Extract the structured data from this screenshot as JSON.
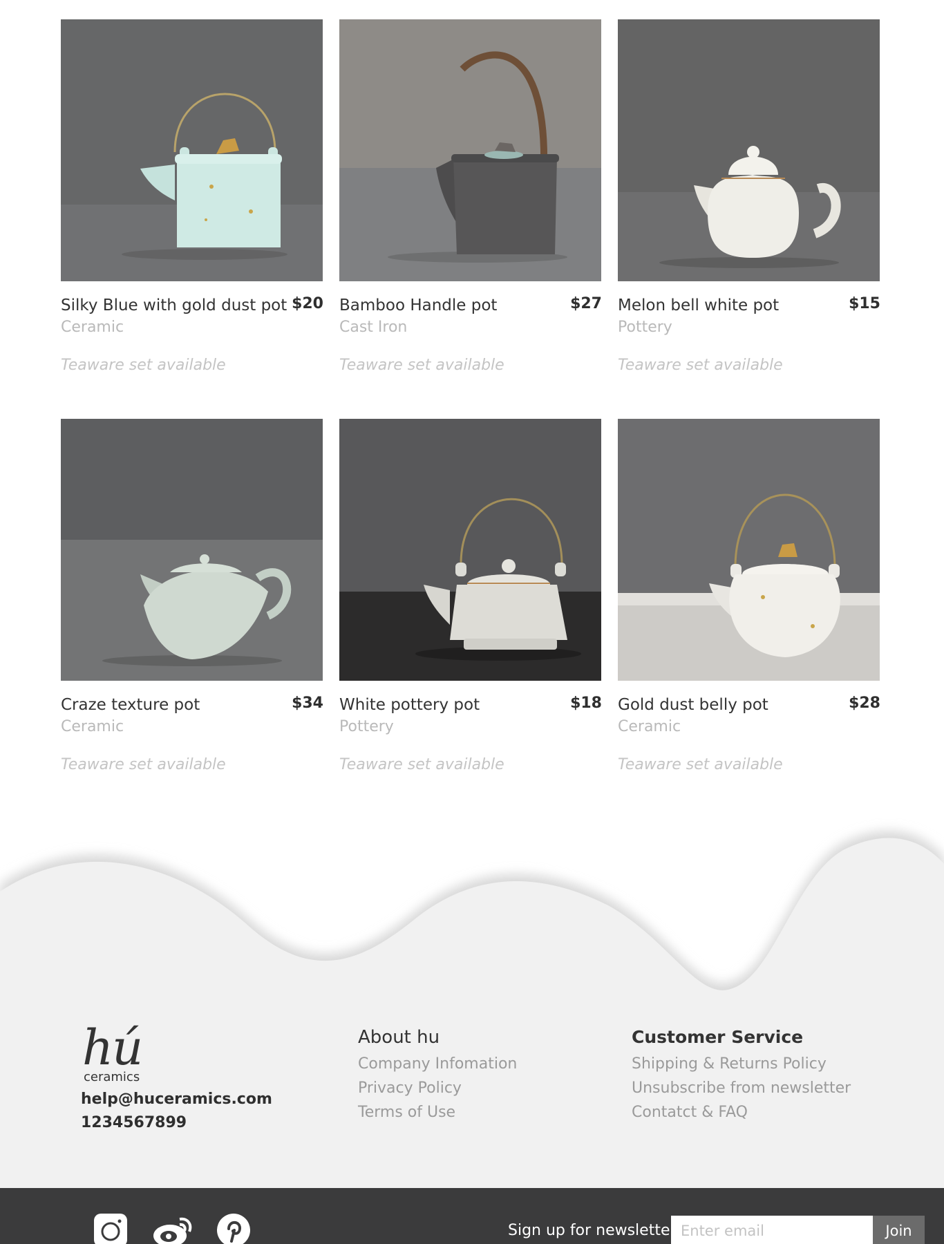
{
  "products": [
    {
      "name": "Silky Blue with gold dust pot",
      "price": "$20",
      "material": "Ceramic",
      "note": "Teaware set available",
      "icon": "teapot-handle-blue-image"
    },
    {
      "name": "Bamboo Handle pot",
      "price": "$27",
      "material": "Cast Iron",
      "note": "Teaware set available",
      "icon": "teapot-bamboo-image"
    },
    {
      "name": "Melon bell white pot",
      "price": "$15",
      "material": "Pottery",
      "note": "Teaware set available",
      "icon": "teapot-white-image"
    },
    {
      "name": "Craze texture pot",
      "price": "$34",
      "material": "Ceramic",
      "note": "Teaware set available",
      "icon": "teapot-craze-image"
    },
    {
      "name": "White pottery pot",
      "price": "$18",
      "material": "Pottery",
      "note": "Teaware set available",
      "icon": "teapot-pottery-image"
    },
    {
      "name": "Gold dust belly pot",
      "price": "$28",
      "material": "Ceramic",
      "note": "Teaware set available",
      "icon": "teapot-gold-belly-image"
    }
  ],
  "footer": {
    "brand": {
      "logo": "hú",
      "sub": "ceramics",
      "email": "help@huceramics.com",
      "phone": "1234567899"
    },
    "about": {
      "title": "About hu",
      "links": [
        "Company Infomation",
        "Privacy Policy",
        "Terms of Use"
      ]
    },
    "service": {
      "title": "Customer Service",
      "links": [
        "Shipping & Returns Policy",
        "Unsubscribe from newsletter",
        "Contatct & FAQ"
      ]
    }
  },
  "bottom_bar": {
    "social_icons": [
      "instagram-icon",
      "weibo-icon",
      "pinterest-icon"
    ],
    "newsletter_label": "Sign up for newsletter",
    "email_placeholder": "Enter email",
    "join_label": "Join"
  },
  "colors": {
    "footer_bg": "#f0f0f0",
    "bottom_bar": "#3b3b3c",
    "join_button": "#6b6b6b",
    "muted_text": "#9a9a9a"
  }
}
